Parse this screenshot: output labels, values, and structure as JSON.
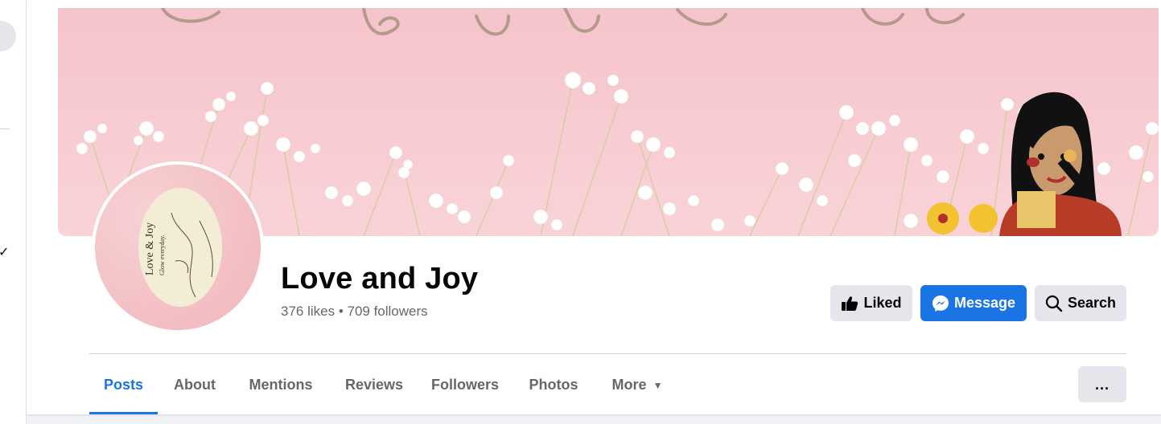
{
  "page": {
    "name": "Love and Joy",
    "stats": "376 likes • 709 followers"
  },
  "cover": {
    "description_colors": {
      "background": "#f7ccd3",
      "flower": "#ffffff",
      "stem": "#d9cfa6"
    }
  },
  "avatar": {
    "logo_title": "Love & Joy",
    "logo_tagline": "Glow everyday."
  },
  "actions": {
    "liked_label": "Liked",
    "message_label": "Message",
    "search_label": "Search"
  },
  "tabs": [
    {
      "label": "Posts",
      "active": true
    },
    {
      "label": "About"
    },
    {
      "label": "Mentions"
    },
    {
      "label": "Reviews"
    },
    {
      "label": "Followers"
    },
    {
      "label": "Photos"
    },
    {
      "label": "More"
    }
  ],
  "more_menu_label": "...",
  "colors": {
    "accent": "#1b74e4",
    "secondary_button": "#e4e6eb",
    "secondary_text": "#65676b",
    "page_background": "#f0f2f5"
  },
  "icons": {
    "liked": "thumbs-up-icon",
    "message": "messenger-icon",
    "search": "search-icon",
    "more": "caret-down-icon",
    "overflow": "ellipsis-icon"
  }
}
